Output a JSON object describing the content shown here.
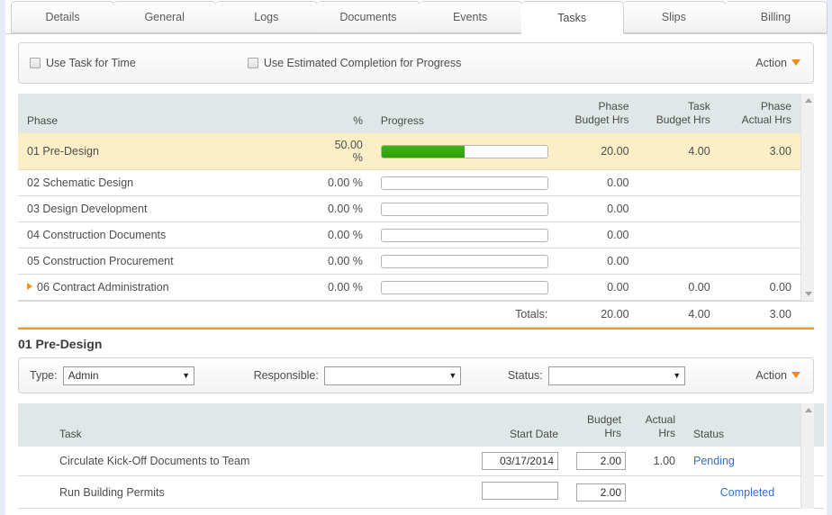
{
  "tabs": [
    {
      "label": "Details",
      "active": false
    },
    {
      "label": "General",
      "active": false
    },
    {
      "label": "Logs",
      "active": false
    },
    {
      "label": "Documents",
      "active": false
    },
    {
      "label": "Events",
      "active": false
    },
    {
      "label": "Tasks",
      "active": true
    },
    {
      "label": "Slips",
      "active": false
    },
    {
      "label": "Billing",
      "active": false
    }
  ],
  "options": {
    "use_task_for_time": "Use Task for Time",
    "use_task_for_time_checked": false,
    "use_estimated_completion": "Use Estimated Completion for Progress",
    "use_estimated_completion_checked": false,
    "action_label": "Action"
  },
  "phase_table": {
    "headers": {
      "phase": "Phase",
      "percent": "%",
      "progress": "Progress",
      "phase_budget_l1": "Phase",
      "phase_budget_l2": "Budget Hrs",
      "task_budget_l1": "Task",
      "task_budget_l2": "Budget Hrs",
      "phase_actual_l1": "Phase",
      "phase_actual_l2": "Actual Hrs"
    },
    "rows": [
      {
        "phase": "01 Pre-Design",
        "percent": "50.00 %",
        "progress": 50,
        "phase_budget": "20.00",
        "task_budget": "4.00",
        "phase_actual": "3.00",
        "highlight": true,
        "expandable": false
      },
      {
        "phase": "02 Schematic Design",
        "percent": "0.00 %",
        "progress": 0,
        "phase_budget": "0.00",
        "task_budget": "",
        "phase_actual": "",
        "highlight": false,
        "expandable": false
      },
      {
        "phase": "03 Design Development",
        "percent": "0.00 %",
        "progress": 0,
        "phase_budget": "0.00",
        "task_budget": "",
        "phase_actual": "",
        "highlight": false,
        "expandable": false
      },
      {
        "phase": "04 Construction Documents",
        "percent": "0.00 %",
        "progress": 0,
        "phase_budget": "0.00",
        "task_budget": "",
        "phase_actual": "",
        "highlight": false,
        "expandable": false
      },
      {
        "phase": "05 Construction Procurement",
        "percent": "0.00 %",
        "progress": 0,
        "phase_budget": "0.00",
        "task_budget": "",
        "phase_actual": "",
        "highlight": false,
        "expandable": false
      },
      {
        "phase": "06 Contract Administration",
        "percent": "0.00 %",
        "progress": 0,
        "phase_budget": "0.00",
        "task_budget": "0.00",
        "phase_actual": "0.00",
        "highlight": false,
        "expandable": true
      }
    ],
    "totals": {
      "label": "Totals:",
      "phase_budget": "20.00",
      "task_budget": "4.00",
      "phase_actual": "3.00"
    }
  },
  "section": {
    "title": "01 Pre-Design"
  },
  "filters": {
    "type_label": "Type:",
    "type_value": "Admin",
    "responsible_label": "Responsible:",
    "responsible_value": "",
    "status_label": "Status:",
    "status_value": "",
    "action_label": "Action"
  },
  "task_table": {
    "headers": {
      "task": "Task",
      "start_date": "Start Date",
      "budget_l1": "Budget",
      "budget_l2": "Hrs",
      "actual_l1": "Actual",
      "actual_l2": "Hrs",
      "status": "Status"
    },
    "rows": [
      {
        "task": "Circulate Kick-Off Documents to Team",
        "start_date": "03/17/2014",
        "budget_hrs": "2.00",
        "actual_hrs": "1.00",
        "status": "Pending"
      },
      {
        "task": "Run Building Permits",
        "start_date": "",
        "budget_hrs": "2.00",
        "actual_hrs": "",
        "status": "Completed"
      }
    ]
  },
  "colors": {
    "accent_orange": "#f0a014",
    "progress_green": "#2f9e0a",
    "header_bg": "#dfe7e7",
    "highlight_row": "#fcefc7",
    "link_blue": "#2f6fd0"
  }
}
